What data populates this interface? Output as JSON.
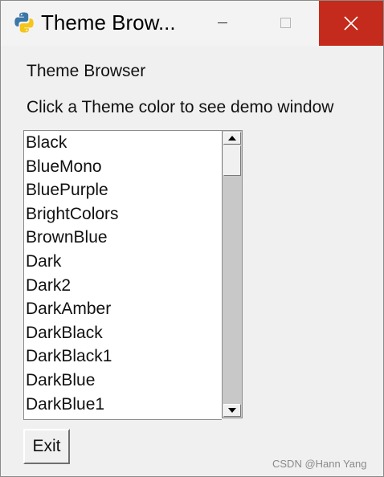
{
  "window": {
    "title": "Theme Brow...",
    "icon": "python-icon",
    "controls": {
      "minimize": "minimize-icon",
      "maximize": "maximize-icon",
      "close": "close-icon"
    }
  },
  "content": {
    "heading": "Theme Browser",
    "instruction": "Click a Theme color to see demo window",
    "themes": [
      "Black",
      "BlueMono",
      "BluePurple",
      "BrightColors",
      "BrownBlue",
      "Dark",
      "Dark2",
      "DarkAmber",
      "DarkBlack",
      "DarkBlack1",
      "DarkBlue",
      "DarkBlue1"
    ],
    "exit_label": "Exit"
  },
  "watermark": "CSDN @Hann Yang",
  "colors": {
    "close_button": "#c42b1c",
    "titlebar": "#f3f3f3",
    "window_bg": "#f0f0f0"
  }
}
